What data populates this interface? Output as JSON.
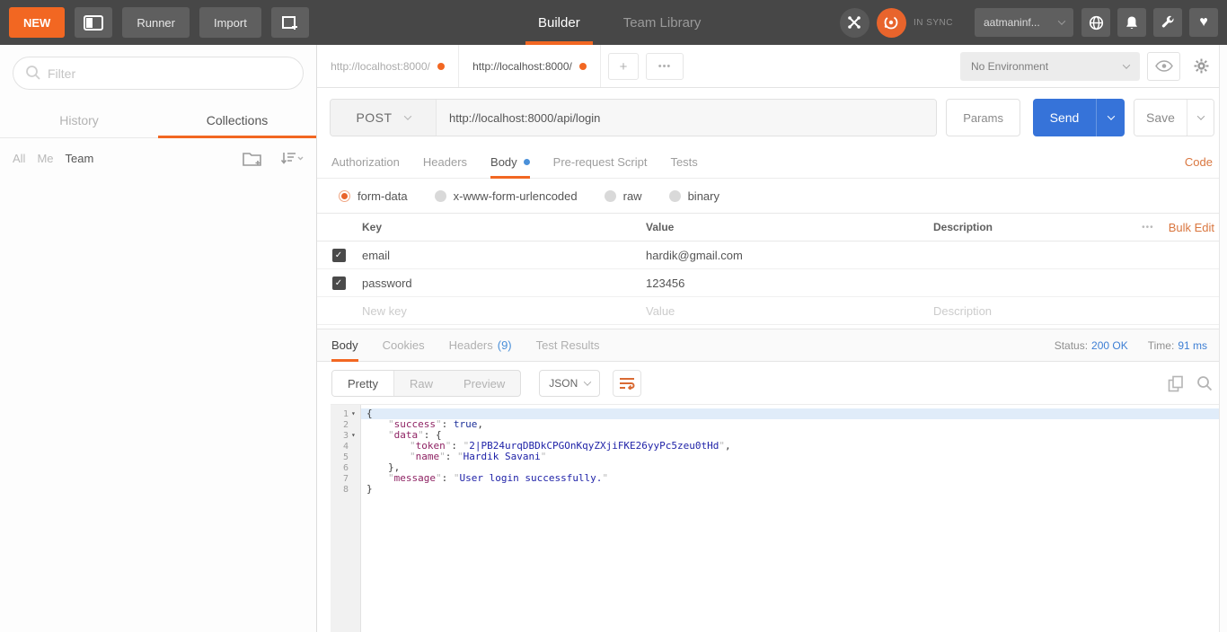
{
  "colors": {
    "accent": "#f26722",
    "blue": "#3e7fd4",
    "send_button": "#3673d9",
    "topbar_bg": "#474747",
    "status_ok": "#3e7fd4"
  },
  "topbar": {
    "new_label": "NEW",
    "runner_label": "Runner",
    "import_label": "Import",
    "tabs": {
      "builder": "Builder",
      "team_library": "Team Library"
    },
    "sync_status": "IN SYNC",
    "account_name": "aatmaninf..."
  },
  "sidebar": {
    "filter_placeholder": "Filter",
    "tabs": {
      "history": "History",
      "collections": "Collections"
    },
    "scope": {
      "all": "All",
      "me": "Me",
      "team": "Team"
    }
  },
  "tabstrip": {
    "tab1": "http://localhost:8000/",
    "tab2": "http://localhost:8000/",
    "plus": "+",
    "more": "•••",
    "environment": "No Environment"
  },
  "request": {
    "method": "POST",
    "url": "http://localhost:8000/api/login",
    "params_label": "Params",
    "send_label": "Send",
    "save_label": "Save",
    "tabs": {
      "authorization": "Authorization",
      "headers": "Headers",
      "body": "Body",
      "prerequest": "Pre-request Script",
      "tests": "Tests"
    },
    "code_label": "Code",
    "body_modes": {
      "formdata": "form-data",
      "urlencoded": "x-www-form-urlencoded",
      "raw": "raw",
      "binary": "binary"
    },
    "selected_mode": "form-data",
    "table": {
      "headers": {
        "key": "Key",
        "value": "Value",
        "description": "Description"
      },
      "ellipsis": "•••",
      "bulk_edit_label": "Bulk Edit",
      "check_glyph": "✓",
      "rows": [
        {
          "key": "email",
          "value": "hardik@gmail.com",
          "description": "",
          "checked": true
        },
        {
          "key": "password",
          "value": "123456",
          "description": "",
          "checked": true
        }
      ],
      "placeholders": {
        "key": "New key",
        "value": "Value",
        "description": "Description"
      }
    }
  },
  "response": {
    "tabs": {
      "body": "Body",
      "cookies": "Cookies",
      "headers": "Headers",
      "headers_count": "(9)",
      "test_results": "Test Results"
    },
    "status_label": "Status:",
    "status_value": "200 OK",
    "time_label": "Time:",
    "time_value": "91 ms",
    "view_modes": {
      "pretty": "Pretty",
      "raw": "Raw",
      "preview": "Preview"
    },
    "format": "JSON",
    "code": {
      "fold_glyph": "▾",
      "lines": [
        {
          "n": "1",
          "fold": true,
          "indent": 0,
          "active": true,
          "tokens": [
            [
              "p",
              "{"
            ]
          ]
        },
        {
          "n": "2",
          "fold": false,
          "indent": 1,
          "active": false,
          "tokens": [
            [
              "k",
              "success"
            ],
            [
              "p",
              ": "
            ],
            [
              "a",
              "true"
            ],
            [
              "p",
              ","
            ]
          ]
        },
        {
          "n": "3",
          "fold": true,
          "indent": 1,
          "active": false,
          "tokens": [
            [
              "k",
              "data"
            ],
            [
              "p",
              ": {"
            ]
          ]
        },
        {
          "n": "4",
          "fold": false,
          "indent": 2,
          "active": false,
          "tokens": [
            [
              "k",
              "token"
            ],
            [
              "p",
              ": "
            ],
            [
              "s",
              "2|PB24urqDBDkCPGOnKqyZXjiFKE26yyPc5zeu0tHd"
            ],
            [
              "p",
              ","
            ]
          ]
        },
        {
          "n": "5",
          "fold": false,
          "indent": 2,
          "active": false,
          "tokens": [
            [
              "k",
              "name"
            ],
            [
              "p",
              ": "
            ],
            [
              "s",
              "Hardik Savani"
            ]
          ]
        },
        {
          "n": "6",
          "fold": false,
          "indent": 1,
          "active": false,
          "tokens": [
            [
              "p",
              "},"
            ]
          ]
        },
        {
          "n": "7",
          "fold": false,
          "indent": 1,
          "active": false,
          "tokens": [
            [
              "k",
              "message"
            ],
            [
              "p",
              ": "
            ],
            [
              "s",
              "User login successfully."
            ]
          ]
        },
        {
          "n": "8",
          "fold": false,
          "indent": 0,
          "active": false,
          "tokens": [
            [
              "p",
              "}"
            ]
          ]
        }
      ]
    }
  }
}
